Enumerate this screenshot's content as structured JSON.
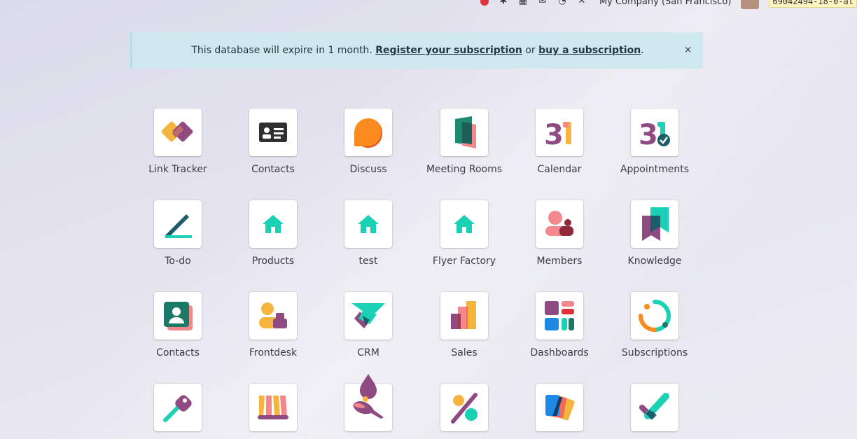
{
  "systray": {
    "company": "My Company (San Francisco)",
    "database": "69042494-18-0-al"
  },
  "alert": {
    "text_before": "This database will expire in 1 month.",
    "link_register": "Register your subscription",
    "text_middle": "or",
    "link_buy": "buy a subscription",
    "text_after": ".",
    "close_symbol": "×"
  },
  "apps": [
    {
      "label": "Link Tracker",
      "icon": "link-tracker-icon"
    },
    {
      "label": "Contacts",
      "icon": "contacts-card-icon"
    },
    {
      "label": "Discuss",
      "icon": "discuss-icon"
    },
    {
      "label": "Meeting Rooms",
      "icon": "meeting-rooms-icon"
    },
    {
      "label": "Calendar",
      "icon": "calendar-icon"
    },
    {
      "label": "Appointments",
      "icon": "appointments-icon"
    },
    {
      "label": "To-do",
      "icon": "todo-icon"
    },
    {
      "label": "Products",
      "icon": "home-icon"
    },
    {
      "label": "test",
      "icon": "home-icon"
    },
    {
      "label": "Flyer Factory",
      "icon": "home-icon"
    },
    {
      "label": "Members",
      "icon": "members-icon"
    },
    {
      "label": "Knowledge",
      "icon": "knowledge-icon"
    },
    {
      "label": "Contacts",
      "icon": "contacts-person-icon"
    },
    {
      "label": "Frontdesk",
      "icon": "frontdesk-icon"
    },
    {
      "label": "CRM",
      "icon": "crm-icon"
    },
    {
      "label": "Sales",
      "icon": "sales-icon"
    },
    {
      "label": "Dashboards",
      "icon": "dashboards-icon"
    },
    {
      "label": "Subscriptions",
      "icon": "subscriptions-icon"
    },
    {
      "label": "",
      "icon": "tool-icon"
    },
    {
      "label": "",
      "icon": "shop-icon"
    },
    {
      "label": "",
      "icon": "paint-icon"
    },
    {
      "label": "",
      "icon": "discount-icon"
    },
    {
      "label": "",
      "icon": "cards-icon"
    },
    {
      "label": "",
      "icon": "checkmark-icon"
    }
  ],
  "calendar_digits": "31",
  "colors": {
    "alert_bg": "#cfe8ef",
    "teal": "#1ad1b5",
    "purple": "#8e4a81",
    "orange": "#f5a623",
    "pink": "#f2888b"
  }
}
